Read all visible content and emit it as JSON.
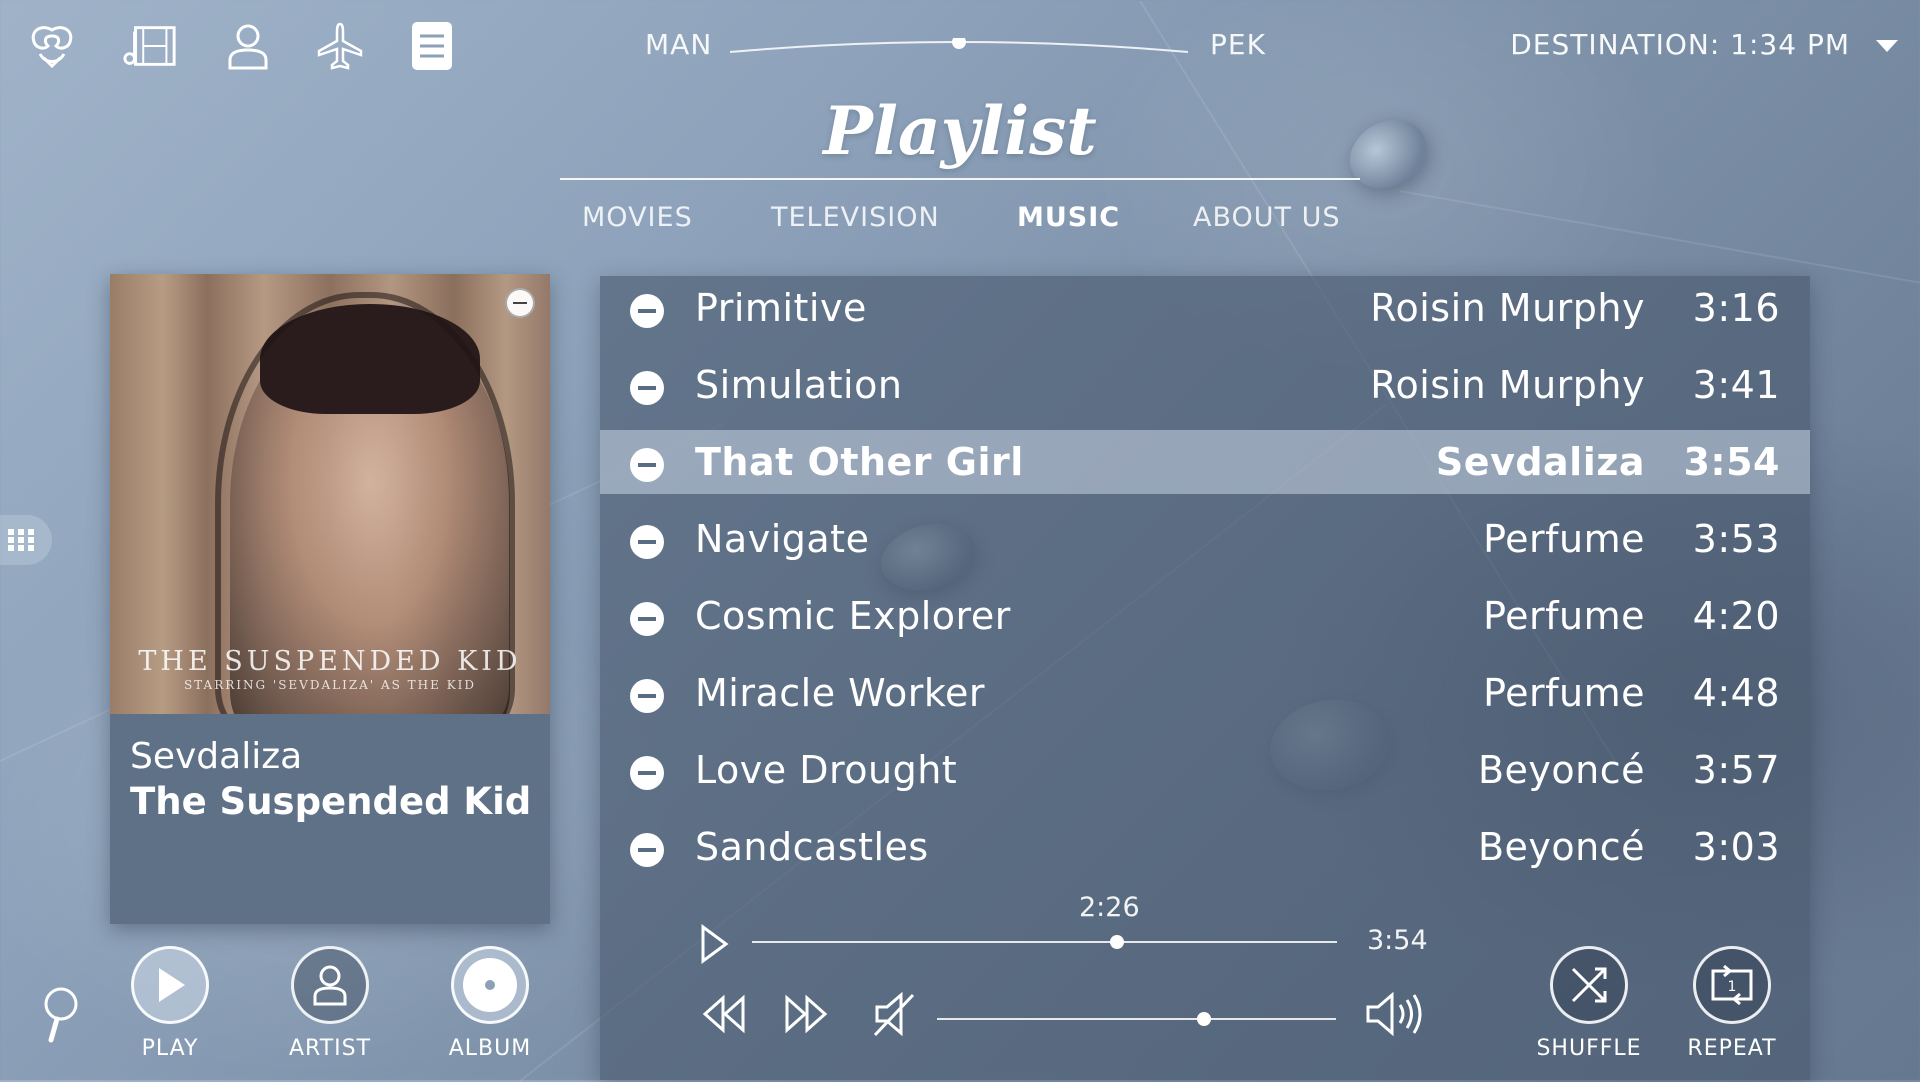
{
  "top_nav": {
    "icons": [
      "logo-icon",
      "film-icon",
      "user-icon",
      "airplane-icon",
      "menu-icon"
    ],
    "route_origin": "MAN",
    "route_dest": "PEK",
    "flight_progress": 0.5,
    "destination_time": "DESTINATION: 1:34 PM"
  },
  "page": {
    "title": "Playlist",
    "tabs": [
      {
        "label": "MOVIES",
        "active": false
      },
      {
        "label": "TELEVISION",
        "active": false
      },
      {
        "label": "MUSIC",
        "active": true
      },
      {
        "label": "ABOUT US",
        "active": false
      }
    ]
  },
  "now_playing": {
    "artist": "Sevdaliza",
    "album": "The Suspended Kid",
    "art_title": "THE SUSPENDED KID",
    "art_subtitle": "STARRING 'SEVDALIZA' AS THE KID"
  },
  "playlist": {
    "tracks": [
      {
        "title": "Primitive",
        "artist": "Roisin Murphy",
        "duration": "3:16",
        "selected": false
      },
      {
        "title": "Simulation",
        "artist": "Roisin Murphy",
        "duration": "3:41",
        "selected": false
      },
      {
        "title": "That Other Girl",
        "artist": "Sevdaliza",
        "duration": "3:54",
        "selected": true
      },
      {
        "title": "Navigate",
        "artist": "Perfume",
        "duration": "3:53",
        "selected": false
      },
      {
        "title": "Cosmic Explorer",
        "artist": "Perfume",
        "duration": "4:20",
        "selected": false
      },
      {
        "title": "Miracle Worker",
        "artist": "Perfume",
        "duration": "4:48",
        "selected": false
      },
      {
        "title": "Love Drought",
        "artist": "Beyoncé",
        "duration": "3:57",
        "selected": false
      },
      {
        "title": "Sandcastles",
        "artist": "Beyoncé",
        "duration": "3:03",
        "selected": false
      }
    ]
  },
  "player": {
    "elapsed": "2:26",
    "total": "3:54",
    "progress": 0.624,
    "volume": 0.67
  },
  "actions": {
    "play_label": "PLAY",
    "artist_label": "ARTIST",
    "album_label": "ALBUM",
    "shuffle_label": "SHUFFLE",
    "repeat_label": "REPEAT",
    "repeat_badge": "1"
  }
}
